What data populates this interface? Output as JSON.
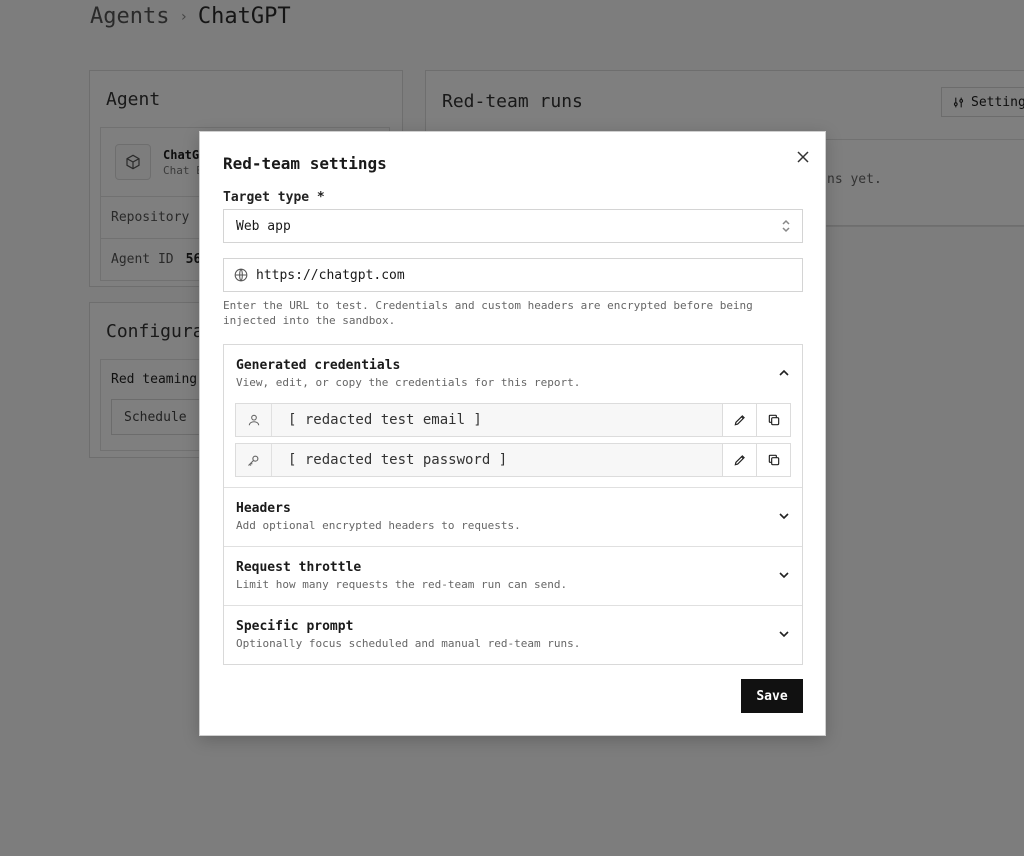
{
  "breadcrumb": {
    "root": "Agents",
    "separator": "›",
    "current": "ChatGPT"
  },
  "agent_card": {
    "title": "Agent",
    "name": "ChatG",
    "subtitle": "Chat E",
    "repository_label": "Repository",
    "agent_id_label": "Agent ID",
    "agent_id_value": "56"
  },
  "config_card": {
    "title": "Configura",
    "red_teaming_label": "Red teaming",
    "schedule_label": "Schedule"
  },
  "runs_card": {
    "title": "Red-team runs",
    "settings_label": "Setting",
    "empty_text": "ns yet."
  },
  "modal": {
    "title": "Red-team settings",
    "target_type_label": "Target type *",
    "target_type_value": "Web app",
    "url_value": "https://chatgpt.com",
    "hint": "Enter the URL to test. Credentials and custom headers are encrypted before being injected into the sandbox.",
    "sections": [
      {
        "title": "Generated credentials",
        "description": "View, edit, or copy the credentials for this report."
      },
      {
        "title": "Headers",
        "description": "Add optional encrypted headers to requests."
      },
      {
        "title": "Request throttle",
        "description": "Limit how many requests the red-team run can send."
      },
      {
        "title": "Specific prompt",
        "description": "Optionally focus scheduled and manual red-team runs."
      }
    ],
    "credentials": {
      "email": "[ redacted test email ]",
      "password": "[ redacted test password ]"
    },
    "save_label": "Save"
  }
}
